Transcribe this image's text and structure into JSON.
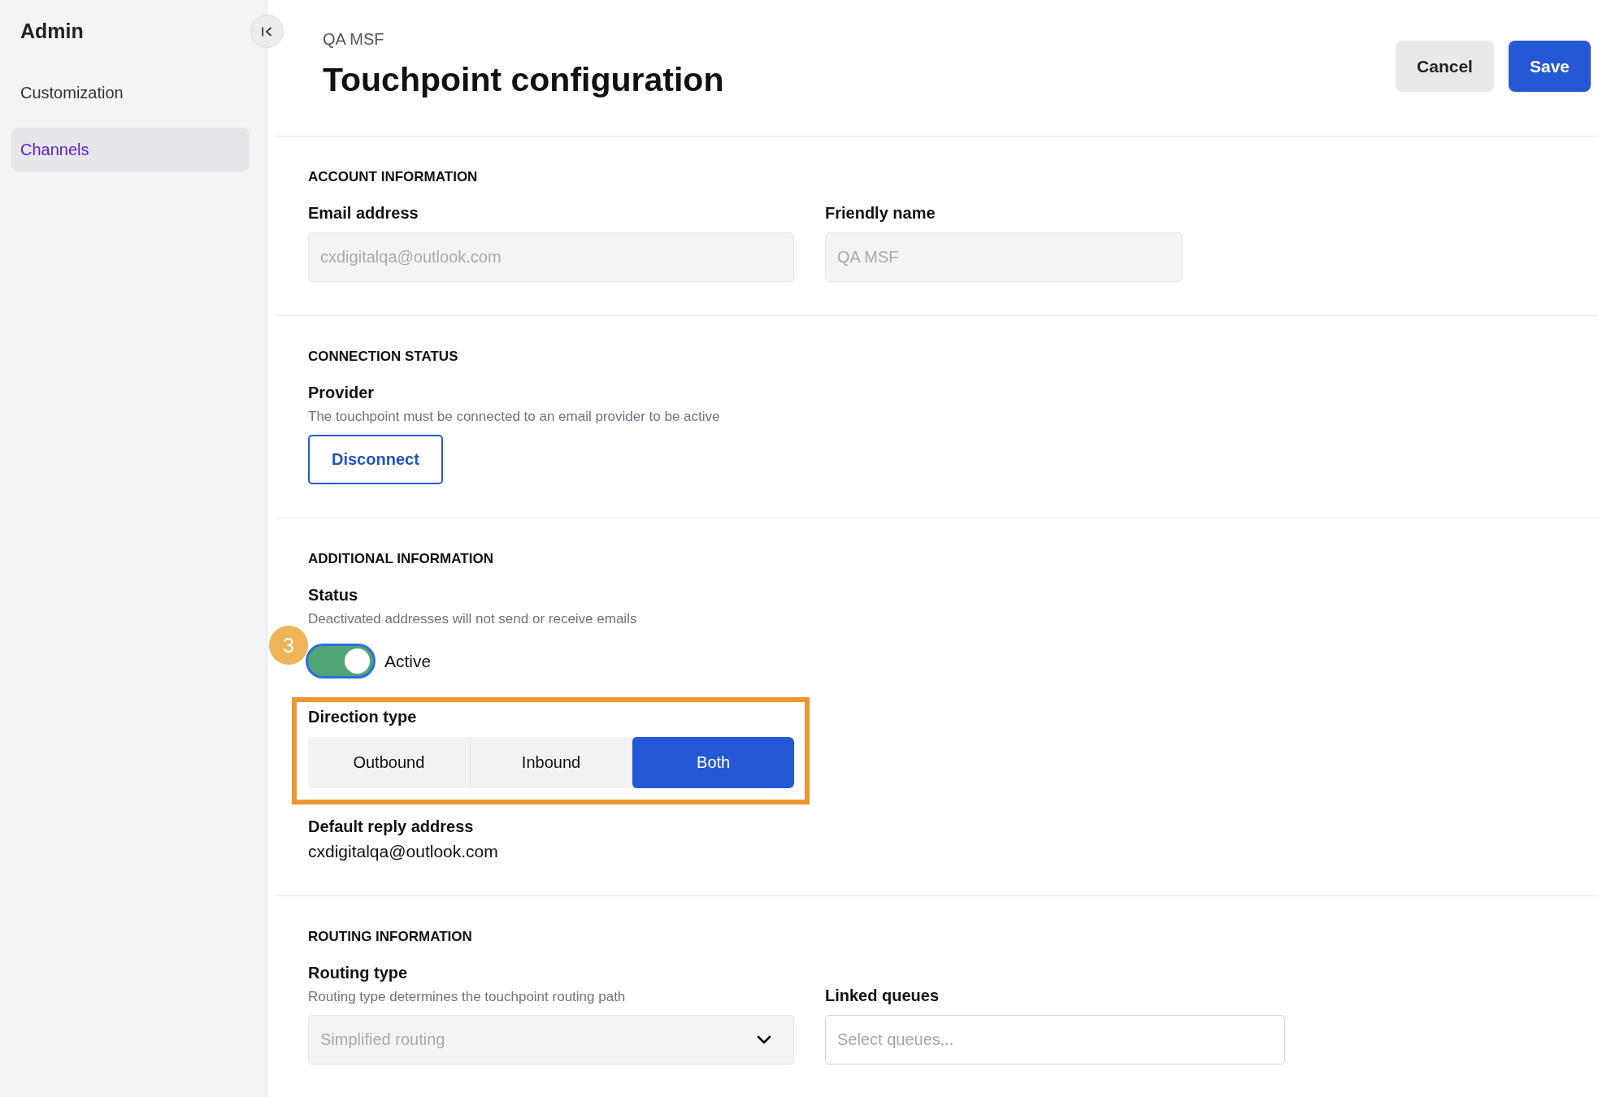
{
  "sidebar": {
    "title": "Admin",
    "items": [
      {
        "label": "Customization",
        "selected": false
      },
      {
        "label": "Channels",
        "selected": true
      }
    ]
  },
  "header": {
    "subtitle": "QA MSF",
    "title": "Touchpoint configuration",
    "actions": [
      {
        "label": "Cancel",
        "kind": "secondary"
      },
      {
        "label": "Save",
        "kind": "primary"
      }
    ]
  },
  "sections": [
    {
      "heading": "ACCOUNT INFORMATION",
      "rows": [
        [
          {
            "kind": "input",
            "label": "Email address",
            "value": "cxdigitalqa@outlook.com",
            "disabled": true
          },
          {
            "kind": "input",
            "label": "Friendly name",
            "value": "QA MSF",
            "disabled": true
          }
        ]
      ]
    },
    {
      "heading": "CONNECTION STATUS",
      "rows": [
        [
          {
            "kind": "button",
            "label": "Provider",
            "hint": "The touchpoint must be connected to an email provider to be active",
            "button": "Disconnect"
          }
        ]
      ]
    },
    {
      "heading": "ADDITIONAL INFORMATION",
      "rows": [
        [
          {
            "kind": "toggle",
            "label": "Status",
            "hint": "Deactivated addresses will not send or receive emails",
            "on": true,
            "focused": true,
            "text": "Active",
            "badge": "3"
          }
        ],
        [
          {
            "kind": "segmented",
            "label": "Direction type",
            "highlighted": true,
            "options": [
              {
                "label": "Outbound",
                "selected": false
              },
              {
                "label": "Inbound",
                "selected": false
              },
              {
                "label": "Both",
                "selected": true
              }
            ]
          }
        ],
        [
          {
            "kind": "text",
            "label": "Default reply address",
            "value": "cxdigitalqa@outlook.com"
          }
        ]
      ]
    },
    {
      "heading": "ROUTING INFORMATION",
      "rows": [
        [
          {
            "kind": "select",
            "label": "Routing type",
            "hint": "Routing type determines the touchpoint routing path",
            "value": "Simplified routing",
            "disabled": true
          },
          {
            "kind": "input",
            "label": "Linked queues",
            "placeholder": "Select queues...",
            "disabled": false
          }
        ]
      ]
    }
  ]
}
